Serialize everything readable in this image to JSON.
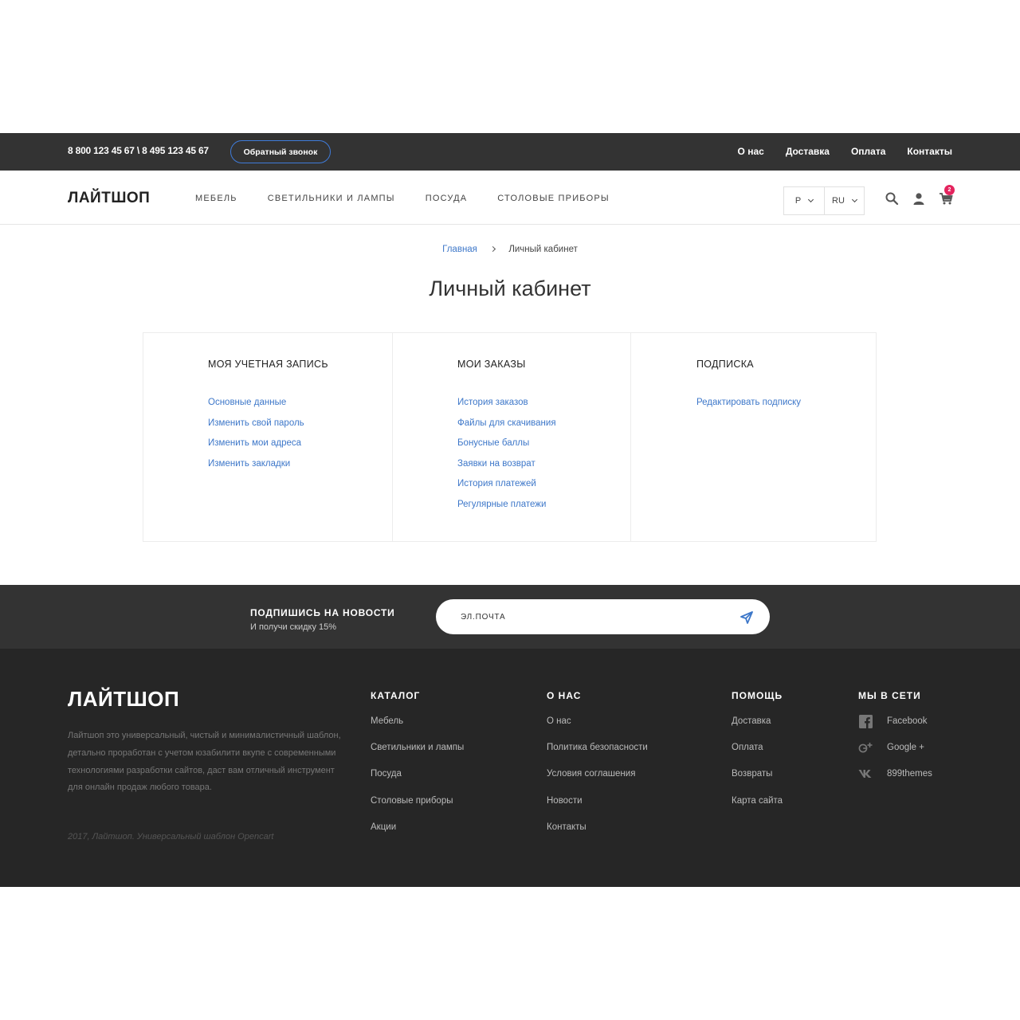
{
  "topbar": {
    "phones": "8 800 123 45 67 \\ 8 495 123 45 67",
    "callback_label": "Обратный звонок",
    "links": [
      "О нас",
      "Доставка",
      "Оплата",
      "Контакты"
    ]
  },
  "header": {
    "logo": "ЛАЙТШОП",
    "nav": [
      "МЕБЕЛЬ",
      "СВЕТИЛЬНИКИ И ЛАМПЫ",
      "ПОСУДА",
      "СТОЛОВЫЕ ПРИБОРЫ"
    ],
    "currency": "Р",
    "language": "RU",
    "cart_count": "2",
    "icons": [
      "search-icon",
      "user-icon",
      "cart-icon"
    ]
  },
  "breadcrumb": {
    "home": "Главная",
    "current": "Личный кабинет"
  },
  "page_title": "Личный кабинет",
  "account": {
    "columns": [
      {
        "title": "МОЯ УЧЕТНАЯ ЗАПИСЬ",
        "links": [
          "Основные данные",
          "Изменить свой пароль",
          "Изменить мои адреса",
          "Изменить закладки"
        ]
      },
      {
        "title": "МОИ ЗАКАЗЫ",
        "links": [
          "История заказов",
          "Файлы для скачивания",
          "Бонусные баллы",
          "Заявки на возврат",
          "История платежей",
          "Регулярные платежи"
        ]
      },
      {
        "title": "ПОДПИСКА",
        "links": [
          "Редактировать подписку"
        ]
      }
    ]
  },
  "newsletter": {
    "title": "ПОДПИШИСЬ НА НОВОСТИ",
    "subtitle": "И получи скидку 15%",
    "placeholder": "ЭЛ.ПОЧТА"
  },
  "footer": {
    "logo": "ЛАЙТШОП",
    "description": "Лайтшоп это универсальный, чистый и минималистичный шаблон, детально проработан с учетом юзабилити вкупе с современными технологиями разработки сайтов, даст вам отличный инструмент для онлайн продаж любого товара.",
    "copyright": "2017, Лайтшоп. Универсальный шаблон Opencart",
    "catalog": {
      "title": "КАТАЛОГ",
      "links": [
        "Мебель",
        "Светильники и лампы",
        "Посуда",
        "Столовые приборы",
        "Акции"
      ]
    },
    "about": {
      "title": "О НАС",
      "links": [
        "О нас",
        "Политика безопасности",
        "Условия соглашения",
        "Новости",
        "Контакты"
      ]
    },
    "help": {
      "title": "ПОМОЩЬ",
      "links": [
        "Доставка",
        "Оплата",
        "Возвраты",
        "Карта сайта"
      ]
    },
    "social": {
      "title": "МЫ В СЕТИ",
      "links": [
        {
          "label": "Facebook",
          "icon": "facebook-icon"
        },
        {
          "label": "Google +",
          "icon": "google-plus-icon"
        },
        {
          "label": "899themes",
          "icon": "vk-icon"
        }
      ]
    }
  },
  "colors": {
    "link": "#3d77c9",
    "dark_bar": "#333333",
    "footer_bg": "#262626",
    "badge": "#e4245e",
    "callback_border": "#3f7bd9"
  }
}
